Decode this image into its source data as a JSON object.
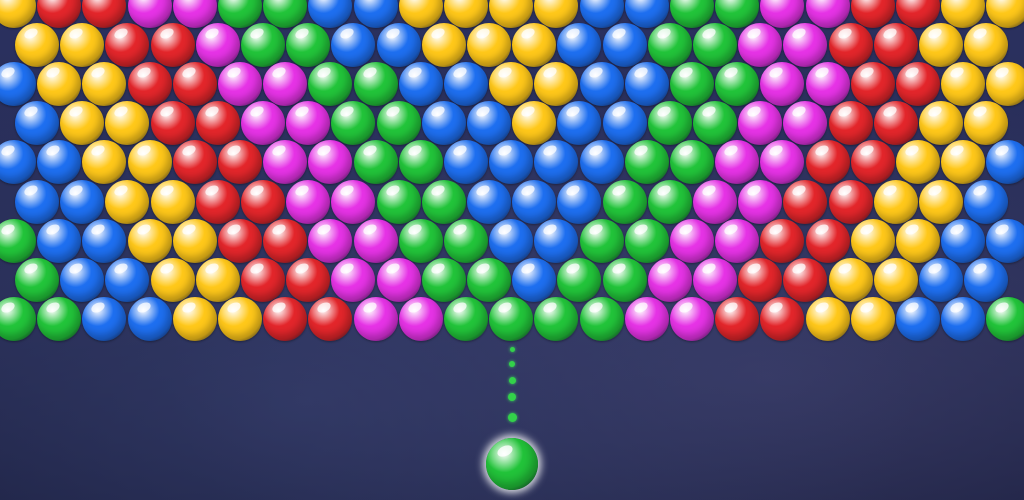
{
  "game": {
    "palette": {
      "R": "#e3262b",
      "Y": "#ffc81a",
      "M": "#e633e6",
      "G": "#22c43a",
      "B": "#1e6ff0"
    },
    "rows": [
      [
        "Y",
        "R",
        "R",
        "M",
        "M",
        "G",
        "G",
        "B",
        "B",
        "Y",
        "Y",
        "Y",
        "Y",
        "B",
        "B",
        "G",
        "G",
        "M",
        "M",
        "R",
        "R",
        "Y",
        "Y"
      ],
      [
        "Y",
        "Y",
        "R",
        "R",
        "M",
        "G",
        "G",
        "B",
        "B",
        "Y",
        "Y",
        "Y",
        "B",
        "B",
        "G",
        "G",
        "M",
        "M",
        "R",
        "R",
        "Y",
        "Y"
      ],
      [
        "B",
        "Y",
        "Y",
        "R",
        "R",
        "M",
        "M",
        "G",
        "G",
        "B",
        "B",
        "Y",
        "Y",
        "B",
        "B",
        "G",
        "G",
        "M",
        "M",
        "R",
        "R",
        "Y",
        "Y"
      ],
      [
        "B",
        "Y",
        "Y",
        "R",
        "R",
        "M",
        "M",
        "G",
        "G",
        "B",
        "B",
        "Y",
        "B",
        "B",
        "G",
        "G",
        "M",
        "M",
        "R",
        "R",
        "Y",
        "Y"
      ],
      [
        "B",
        "B",
        "Y",
        "Y",
        "R",
        "R",
        "M",
        "M",
        "G",
        "G",
        "B",
        "B",
        "B",
        "B",
        "G",
        "G",
        "M",
        "M",
        "R",
        "R",
        "Y",
        "Y",
        "B"
      ],
      [
        "B",
        "B",
        "Y",
        "Y",
        "R",
        "R",
        "M",
        "M",
        "G",
        "G",
        "B",
        "B",
        "B",
        "G",
        "G",
        "M",
        "M",
        "R",
        "R",
        "Y",
        "Y",
        "B"
      ],
      [
        "G",
        "B",
        "B",
        "Y",
        "Y",
        "R",
        "R",
        "M",
        "M",
        "G",
        "G",
        "B",
        "B",
        "G",
        "G",
        "M",
        "M",
        "R",
        "R",
        "Y",
        "Y",
        "B",
        "B"
      ],
      [
        "G",
        "B",
        "B",
        "Y",
        "Y",
        "R",
        "R",
        "M",
        "M",
        "G",
        "G",
        "B",
        "G",
        "G",
        "M",
        "M",
        "R",
        "R",
        "Y",
        "Y",
        "B",
        "B"
      ],
      [
        "G",
        "G",
        "B",
        "B",
        "Y",
        "Y",
        "R",
        "R",
        "M",
        "M",
        "G",
        "G",
        "G",
        "G",
        "M",
        "M",
        "R",
        "R",
        "Y",
        "Y",
        "B",
        "B",
        "G"
      ]
    ],
    "shooter_color": "G"
  }
}
